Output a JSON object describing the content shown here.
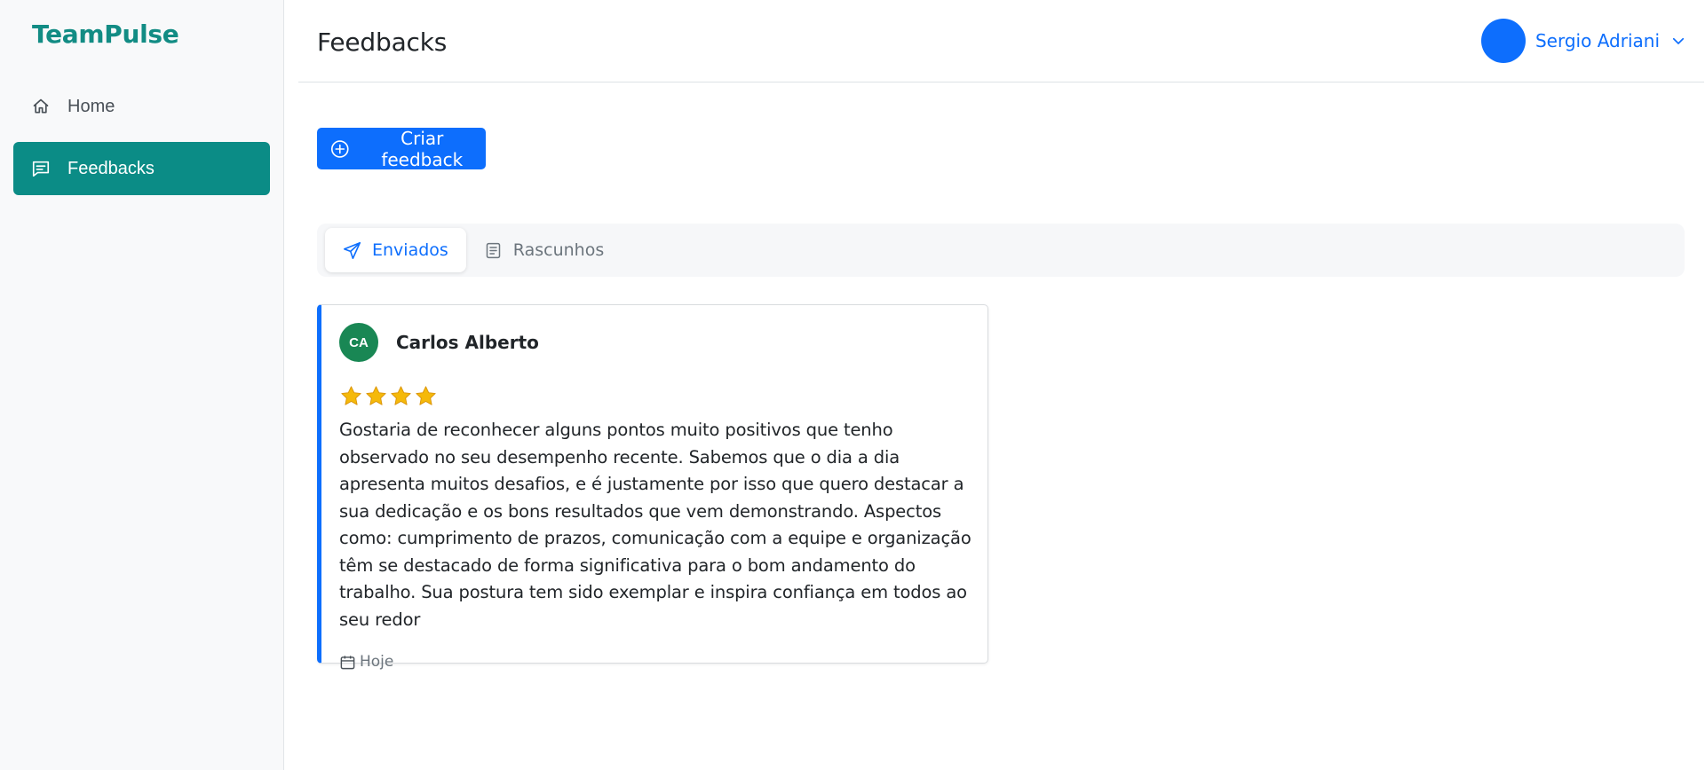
{
  "brand": "TeamPulse",
  "sidebar": {
    "items": [
      {
        "label": "Home",
        "icon": "home-icon"
      },
      {
        "label": "Feedbacks",
        "icon": "chat-icon"
      }
    ]
  },
  "header": {
    "title": "Feedbacks",
    "user_name": "Sergio Adriani"
  },
  "actions": {
    "create_label": "Criar feedback"
  },
  "tabs": [
    {
      "label": "Enviados",
      "icon": "send-icon"
    },
    {
      "label": "Rascunhos",
      "icon": "draft-icon"
    }
  ],
  "feedback": {
    "initials": "CA",
    "name": "Carlos Alberto",
    "rating": 4,
    "message": "Gostaria de reconhecer alguns pontos muito positivos que tenho observado no seu desempenho recente. Sabemos que o dia a dia apresenta muitos desafios, e é justamente por isso que quero destacar a sua dedicação e os bons resultados que vem demonstrando. Aspectos como: cumprimento de prazos, comunicação com a equipe e organização têm se destacado de forma significativa para o bom andamento do trabalho. Sua postura tem sido exemplar e inspira confiança em todos ao seu redor",
    "date": "Hoje"
  },
  "colors": {
    "brand": "#128c84",
    "sidebar_active": "#0b8c86",
    "primary": "#0d6efd",
    "avatar_green": "#198754",
    "star": "#f5b90a"
  }
}
